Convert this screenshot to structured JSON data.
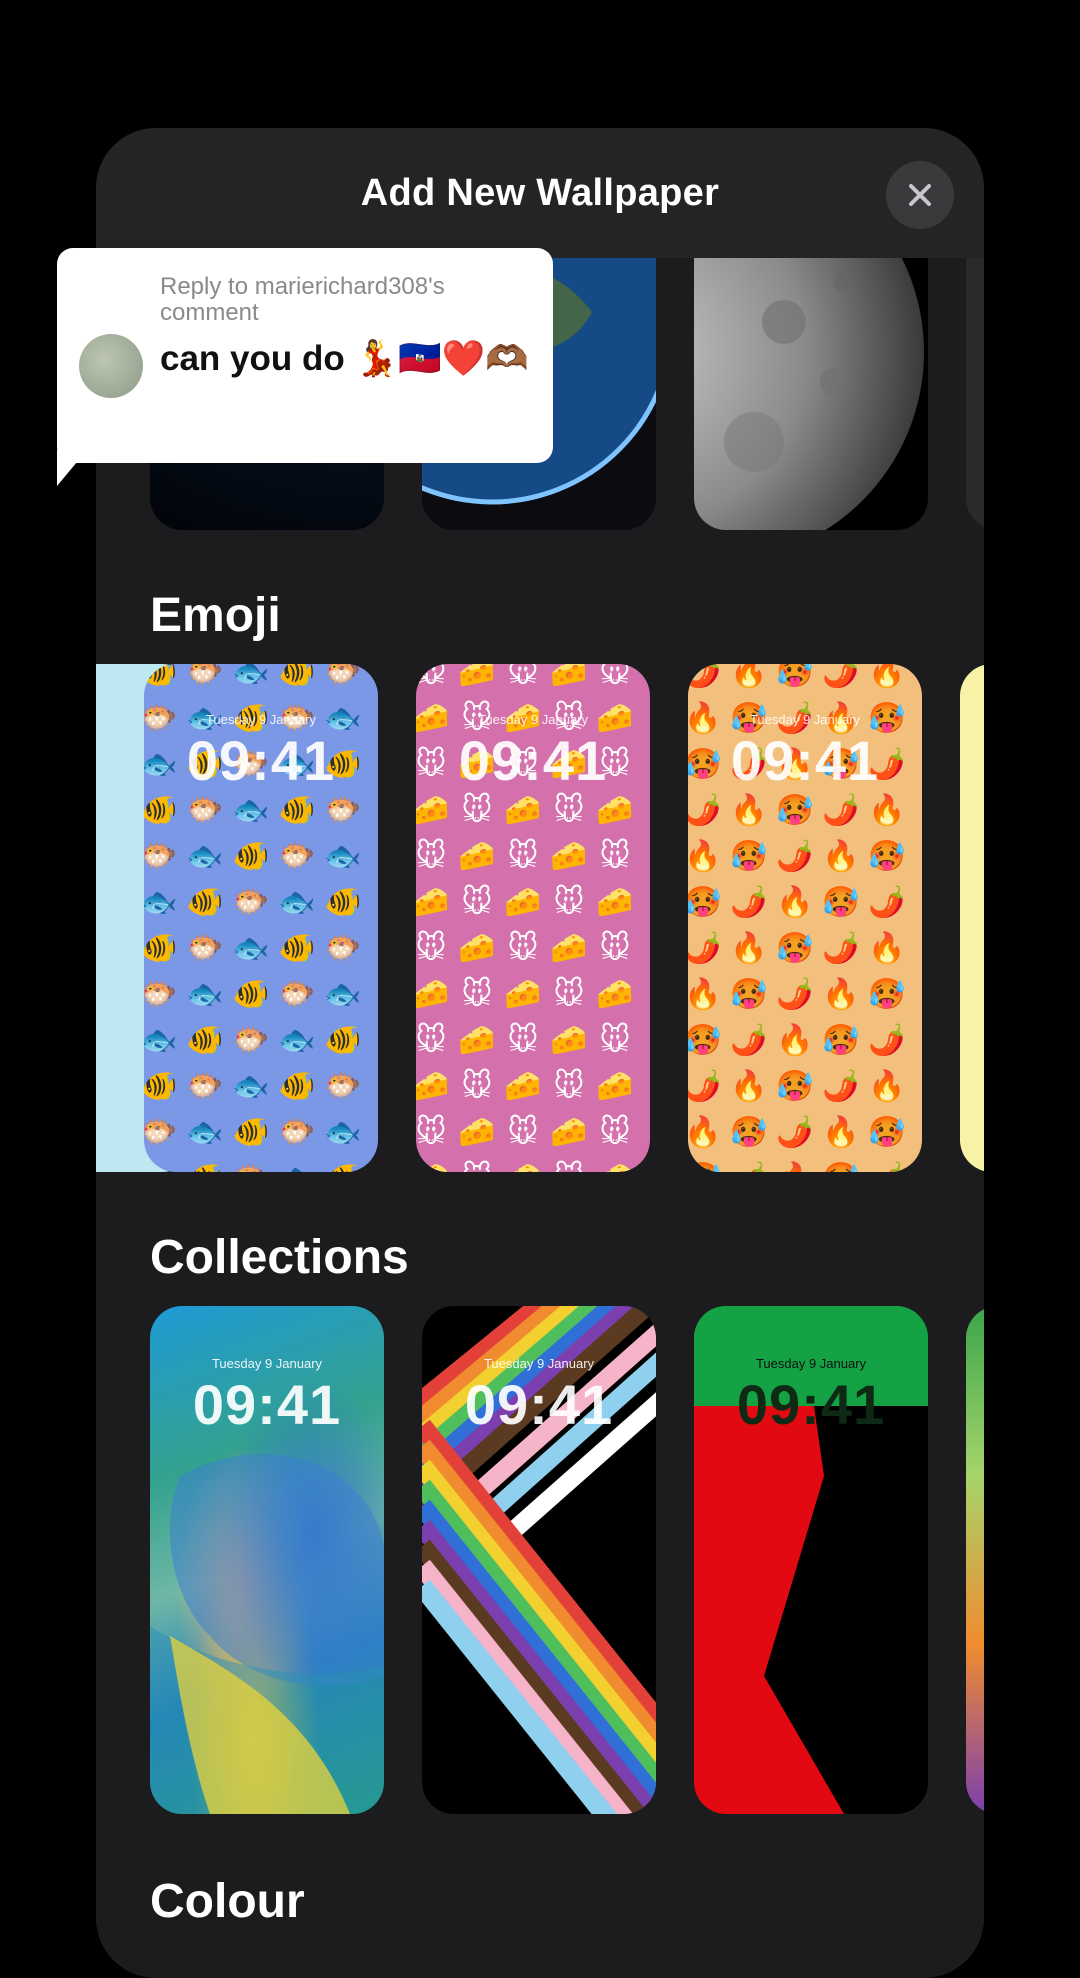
{
  "sheet": {
    "title": "Add New Wallpaper",
    "close_icon": "close-icon"
  },
  "sections": {
    "emoji": "Emoji",
    "collections": "Collections",
    "colour": "Colour"
  },
  "lock_screen": {
    "date": "Tuesday 9 January",
    "time": "09:41"
  },
  "emoji_wallpapers": [
    {
      "name": "fish",
      "emojis": [
        "🐠",
        "🐡",
        "🐟"
      ],
      "background": "#7b98e6"
    },
    {
      "name": "mouse-cheese",
      "emojis": [
        "🐭",
        "🧀"
      ],
      "background": "#d470ac"
    },
    {
      "name": "chili-fire",
      "emojis": [
        "🌶️",
        "🔥",
        "🥵"
      ],
      "background": "#f2c07c"
    }
  ],
  "comment": {
    "reply_label": "Reply to marierichard308's comment",
    "text": "can you do 💃🇭🇹❤️🫶🏾"
  }
}
